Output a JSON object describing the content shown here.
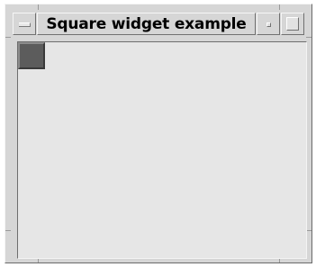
{
  "window": {
    "title": "Square widget example",
    "menu_icon": "window-menu-icon",
    "minimize_icon": "minimize-icon",
    "maximize_icon": "maximize-icon"
  },
  "colors": {
    "frame": "#d6d6d6",
    "client_background": "#e6e6e6",
    "square": "#5c5c5c"
  }
}
